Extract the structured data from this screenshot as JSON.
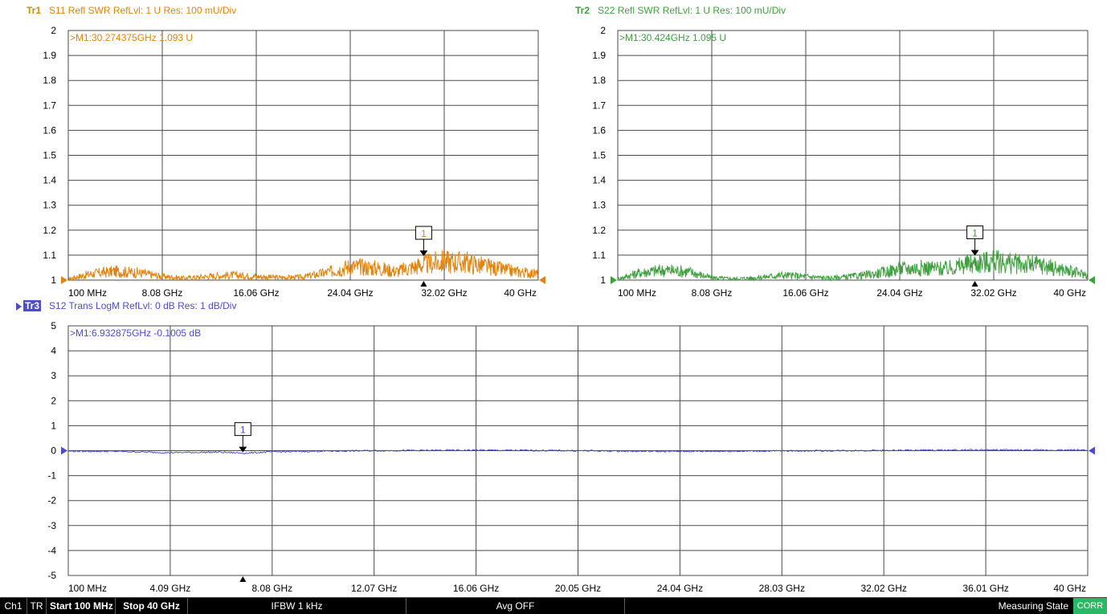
{
  "traces": {
    "tr1": {
      "id": "Tr1",
      "desc": "S11 Refl SWR RefLvl: 1  U Res: 100 mU/Div",
      "color": "#e0830f"
    },
    "tr2": {
      "id": "Tr2",
      "desc": "S22 Refl SWR RefLvl: 1  U Res: 100 mU/Div",
      "color": "#3f9f3f"
    },
    "tr3": {
      "id": "Tr3",
      "desc": "S12 Trans LogM RefLvl: 0  dB Res: 1  dB/Div",
      "color": "#4d4dc8"
    }
  },
  "statusbar": {
    "channel": "Ch1",
    "tr": "TR",
    "start": "Start 100 MHz",
    "stop": "Stop 40 GHz",
    "ifbw": "IFBW 1 kHz",
    "avg": "Avg OFF",
    "state": "Measuring State",
    "corr": "CORR",
    "corr_color": "#2bb864"
  },
  "chart_data": [
    {
      "type": "line",
      "trace": "Tr1",
      "parameter": "S11",
      "format": "SWR",
      "unit": "U",
      "color": "#e0830f",
      "xlim": [
        0.1,
        40
      ],
      "ylim": [
        1,
        2
      ],
      "grid": true,
      "xticks": [
        0.1,
        8.08,
        16.06,
        24.04,
        32.02,
        40
      ],
      "xtick_labels": [
        "100 MHz",
        "8.08 GHz",
        "16.06 GHz",
        "24.04 GHz",
        "32.02 GHz",
        "40 GHz"
      ],
      "yticks": [
        1,
        1.1,
        1.2,
        1.3,
        1.4,
        1.5,
        1.6,
        1.7,
        1.8,
        1.9,
        2
      ],
      "ytick_labels": [
        "1",
        "1.1",
        "1.2",
        "1.3",
        "1.4",
        "1.5",
        "1.6",
        "1.7",
        "1.8",
        "1.9",
        "2"
      ],
      "x": [
        0.1,
        2,
        4,
        6,
        8,
        10,
        12,
        14,
        16,
        18,
        20,
        22,
        24,
        26,
        28,
        30,
        32,
        34,
        36,
        38,
        40
      ],
      "y": [
        1.005,
        1.025,
        1.035,
        1.03,
        1.015,
        1.008,
        1.015,
        1.02,
        1.015,
        1.01,
        1.012,
        1.03,
        1.055,
        1.05,
        1.035,
        1.06,
        1.075,
        1.07,
        1.05,
        1.035,
        1.025
      ],
      "marker": {
        "label": "1",
        "x": 30.274375,
        "y": 1.093,
        "readout": ">M1:30.274375GHz  1.093  U"
      }
    },
    {
      "type": "line",
      "trace": "Tr2",
      "parameter": "S22",
      "format": "SWR",
      "unit": "U",
      "color": "#3f9f3f",
      "xlim": [
        0.1,
        40
      ],
      "ylim": [
        1,
        2
      ],
      "grid": true,
      "xticks": [
        0.1,
        8.08,
        16.06,
        24.04,
        32.02,
        40
      ],
      "xtick_labels": [
        "100 MHz",
        "8.08 GHz",
        "16.06 GHz",
        "24.04 GHz",
        "32.02 GHz",
        "40 GHz"
      ],
      "yticks": [
        1,
        1.1,
        1.2,
        1.3,
        1.4,
        1.5,
        1.6,
        1.7,
        1.8,
        1.9,
        2
      ],
      "ytick_labels": [
        "1",
        "1.1",
        "1.2",
        "1.3",
        "1.4",
        "1.5",
        "1.6",
        "1.7",
        "1.8",
        "1.9",
        "2"
      ],
      "x": [
        0.1,
        2,
        4,
        6,
        8,
        10,
        12,
        14,
        16,
        18,
        20,
        22,
        24,
        26,
        28,
        30,
        32,
        34,
        36,
        38,
        40
      ],
      "y": [
        1.005,
        1.03,
        1.04,
        1.035,
        1.01,
        1.005,
        1.01,
        1.02,
        1.015,
        1.008,
        1.015,
        1.025,
        1.045,
        1.05,
        1.045,
        1.065,
        1.075,
        1.065,
        1.06,
        1.04,
        1.02
      ],
      "marker": {
        "label": "1",
        "x": 30.424,
        "y": 1.095,
        "readout": ">M1:30.424GHz  1.095  U"
      }
    },
    {
      "type": "line",
      "trace": "Tr3",
      "parameter": "S12",
      "format": "LogM",
      "unit": "dB",
      "color": "#4d4dc8",
      "xlim": [
        0.1,
        40
      ],
      "ylim": [
        -5,
        5
      ],
      "grid": true,
      "xticks": [
        0.1,
        4.09,
        8.08,
        12.07,
        16.06,
        20.05,
        24.04,
        28.03,
        32.02,
        36.01,
        40
      ],
      "xtick_labels": [
        "100 MHz",
        "4.09 GHz",
        "8.08 GHz",
        "12.07 GHz",
        "16.06 GHz",
        "20.05 GHz",
        "24.04 GHz",
        "28.03 GHz",
        "32.02 GHz",
        "36.01 GHz",
        "40 GHz"
      ],
      "yticks": [
        -5,
        -4,
        -3,
        -2,
        -1,
        0,
        1,
        2,
        3,
        4,
        5
      ],
      "ytick_labels": [
        "-5",
        "-4",
        "-3",
        "-2",
        "-1",
        "0",
        "1",
        "2",
        "3",
        "4",
        "5"
      ],
      "x": [
        0.1,
        2,
        4,
        6,
        7,
        8,
        10,
        12,
        14,
        16,
        18,
        20,
        22,
        24,
        26,
        28,
        30,
        32,
        34,
        36,
        38,
        40
      ],
      "y": [
        -0.02,
        -0.03,
        -0.08,
        -0.06,
        -0.1,
        -0.05,
        -0.02,
        0.0,
        0.01,
        0.02,
        0.01,
        0.0,
        -0.02,
        -0.03,
        -0.02,
        -0.01,
        0.0,
        0.01,
        0.02,
        0.03,
        0.02,
        0.03
      ],
      "marker": {
        "label": "1",
        "x": 6.932875,
        "y": -0.1005,
        "readout": ">M1:6.932875GHz  -0.1005  dB"
      }
    }
  ]
}
